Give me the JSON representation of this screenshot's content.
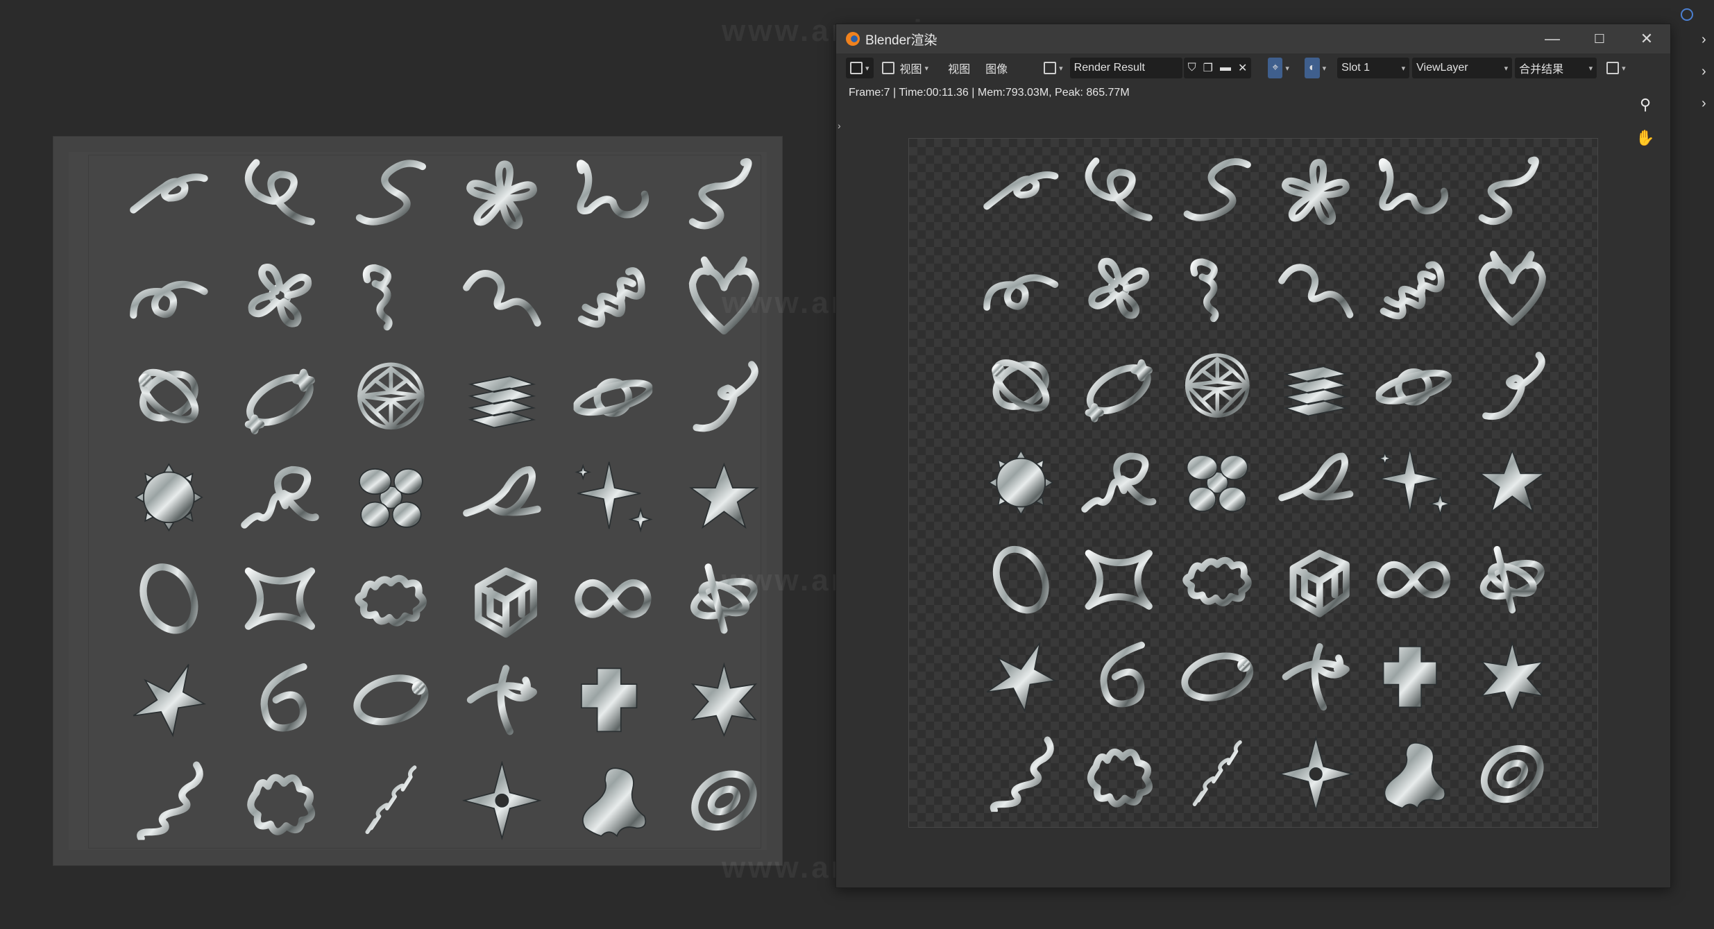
{
  "window": {
    "title": "Blender渲染",
    "controls": {
      "minimize": "—",
      "maximize": "☐",
      "close": "✕"
    }
  },
  "toolbar": {
    "view_label": "视图",
    "view2_label": "视图",
    "image_label": "图像",
    "image_name": "Render Result",
    "slot_label": "Slot 1",
    "viewlayer_label": "ViewLayer",
    "pass_label": "合并结果"
  },
  "status": {
    "text": "Frame:7 | Time:00:11.36 | Mem:793.03M, Peak: 865.77M"
  },
  "watermark": "www.anyusj.com",
  "icons": {
    "zoom": "zoom-icon",
    "pan": "hand-icon",
    "close_image": "close-icon",
    "new_image": "new-image-icon",
    "open_image": "folder-icon",
    "fake_user": "shield-icon"
  },
  "colors": {
    "background": "#2b2b2b",
    "window": "#303030",
    "titlebar": "#3b3b3b",
    "accent": "#3f5f8d"
  }
}
